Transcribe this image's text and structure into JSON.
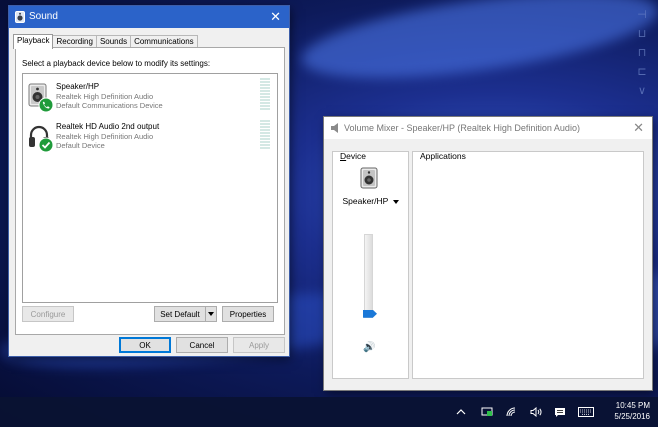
{
  "sound_dialog": {
    "title": "Sound",
    "close_glyph": "✕",
    "tabs": [
      "Playback",
      "Recording",
      "Sounds",
      "Communications"
    ],
    "active_tab": "Playback",
    "instruction": "Select a playback device below to modify its settings:",
    "devices": [
      {
        "name": "Speaker/HP",
        "driver": "Realtek High Definition Audio",
        "status": "Default Communications Device",
        "icon": "speaker-icon",
        "badge": "phone-check-badge"
      },
      {
        "name": "Realtek HD Audio 2nd output",
        "driver": "Realtek High Definition Audio",
        "status": "Default Device",
        "icon": "headphones-icon",
        "badge": "check-badge"
      }
    ],
    "buttons": {
      "configure": "Configure",
      "set_default": "Set Default",
      "properties": "Properties",
      "ok": "OK",
      "cancel": "Cancel",
      "apply": "Apply"
    }
  },
  "volume_mixer": {
    "title": "Volume Mixer - Speaker/HP (Realtek High Definition Audio)",
    "close_glyph": "✕",
    "device_header_first": "D",
    "device_header_rest": "evice",
    "applications_header": "Applications",
    "device_name": "Speaker/HP",
    "volume_level": 0.05,
    "speaker_glyph": "🔊"
  },
  "taskbar": {
    "time": "10:45 PM",
    "date": "5/25/2016",
    "tray_icons": [
      "show-hidden-icons-chevron",
      "network-icon",
      "wifi-icon",
      "volume-icon",
      "action-center-icon",
      "keyboard-icon"
    ]
  },
  "colors": {
    "titlebar_active": "#2b63c9",
    "accent": "#0078d7",
    "check_green": "#1f9b3a"
  }
}
